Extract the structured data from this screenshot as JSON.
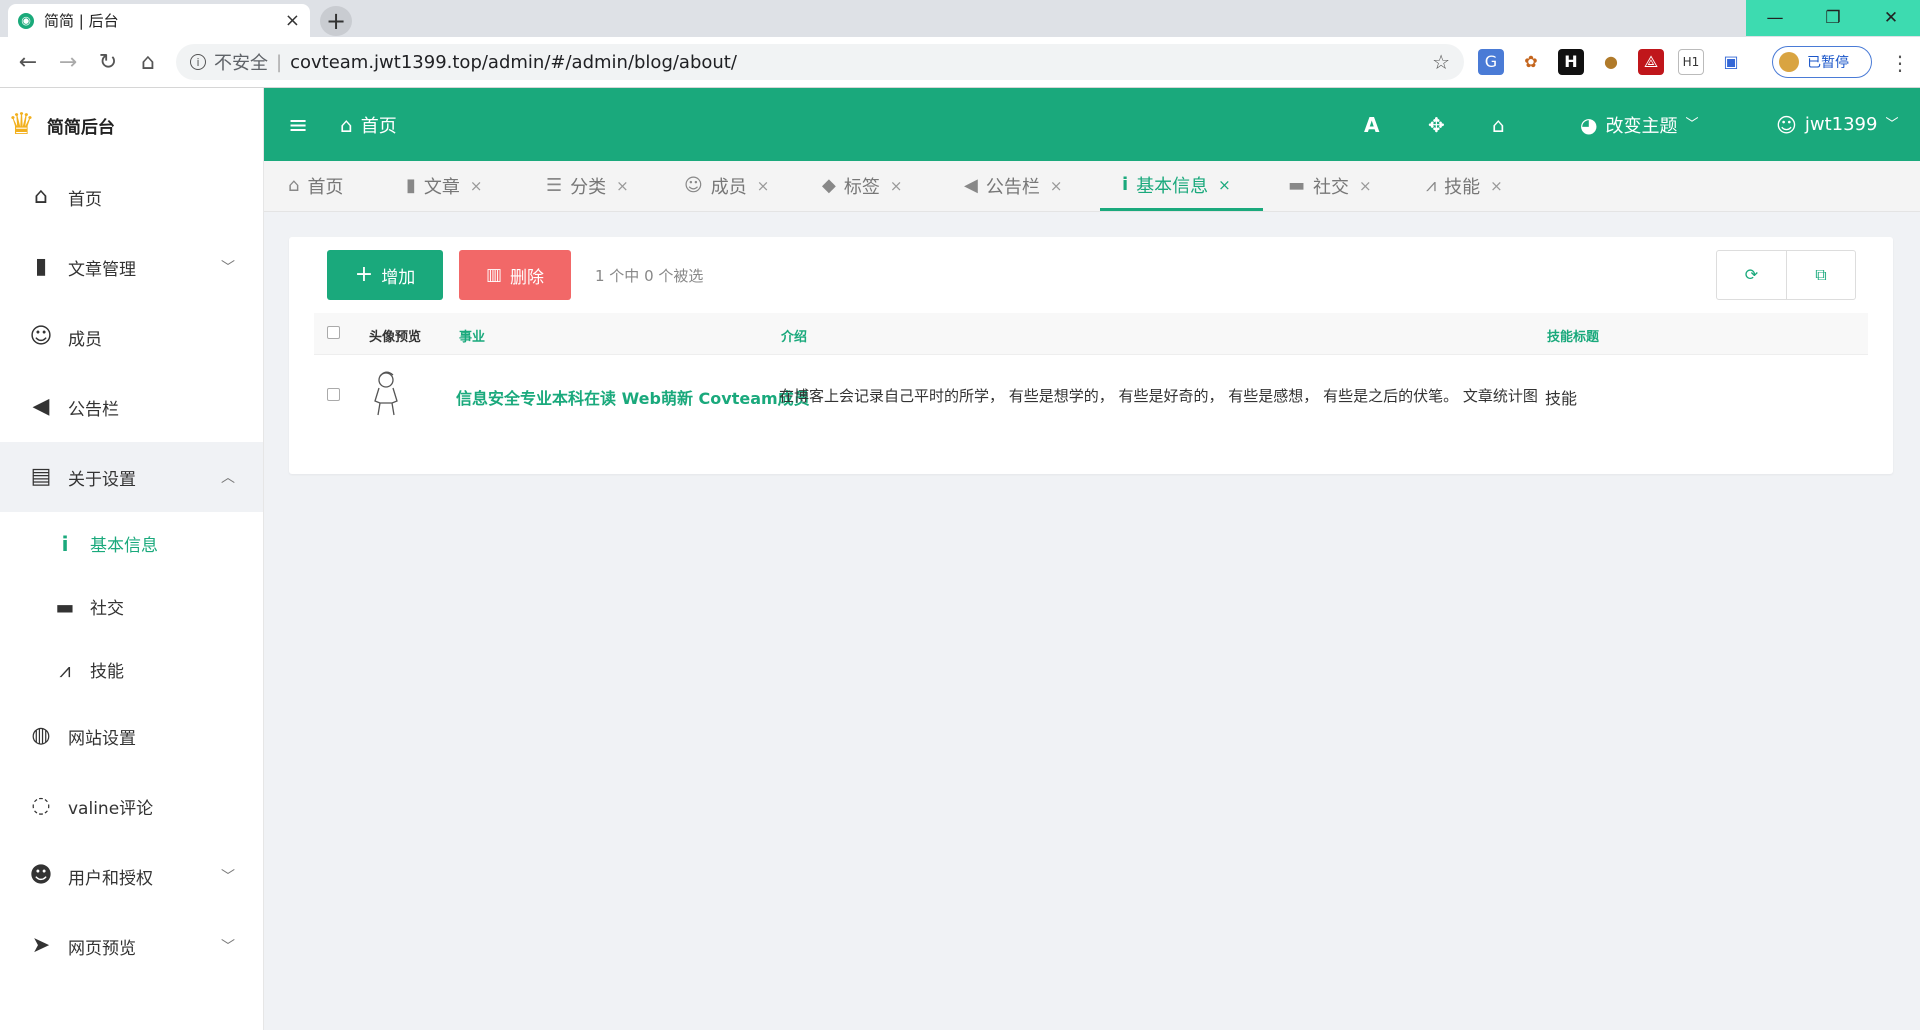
{
  "browser": {
    "tab_title": "简简 | 后台",
    "tab_close": "×",
    "new_tab": "+",
    "win_min": "—",
    "win_restore": "❐",
    "win_close": "✕",
    "back": "←",
    "forward": "→",
    "reload": "↻",
    "home": "⌂",
    "insecure_label": "不安全",
    "sep": "|",
    "url": "covteam.jwt1399.top/admin/#/admin/blog/about/",
    "star": "☆",
    "paused_label": "已暂停",
    "menu": "⋮",
    "ext_h1": "H1"
  },
  "sidebar": {
    "brand": "简简后台",
    "items": [
      {
        "label": "首页",
        "icon": "home-icon"
      },
      {
        "label": "文章管理",
        "icon": "book-icon",
        "caret": "﹀"
      },
      {
        "label": "成员",
        "icon": "user-icon"
      },
      {
        "label": "公告栏",
        "icon": "bullhorn-icon"
      },
      {
        "label": "关于设置",
        "icon": "id-card-icon",
        "caret": "︿"
      },
      {
        "label": "网站设置",
        "icon": "globe-icon"
      },
      {
        "label": "valine评论",
        "icon": "comments-icon"
      },
      {
        "label": "用户和授权",
        "icon": "user-lock-icon",
        "caret": "﹀"
      },
      {
        "label": "网页预览",
        "icon": "paper-plane-icon",
        "caret": "﹀"
      }
    ],
    "sub_items": [
      {
        "label": "基本信息",
        "icon": "info-icon"
      },
      {
        "label": "社交",
        "icon": "comment-icon"
      },
      {
        "label": "技能",
        "icon": "drafting-compass-icon"
      }
    ]
  },
  "header": {
    "hamburger": "≡",
    "home_label": "首页",
    "font_icon": "A",
    "theme_label": "改变主题",
    "user_label": "jwt1399",
    "caret": "﹀"
  },
  "page_tabs": [
    {
      "label": "首页",
      "icon": "home-icon",
      "closable": false
    },
    {
      "label": "文章",
      "icon": "book-icon",
      "closable": true
    },
    {
      "label": "分类",
      "icon": "list-icon",
      "closable": true
    },
    {
      "label": "成员",
      "icon": "user-icon",
      "closable": true
    },
    {
      "label": "标签",
      "icon": "tags-icon",
      "closable": true
    },
    {
      "label": "公告栏",
      "icon": "bullhorn-icon",
      "closable": true
    },
    {
      "label": "基本信息",
      "icon": "info-icon",
      "closable": true,
      "active": true
    },
    {
      "label": "社交",
      "icon": "comment-icon",
      "closable": true
    },
    {
      "label": "技能",
      "icon": "drafting-compass-icon",
      "closable": true
    }
  ],
  "tab_close": "×",
  "content": {
    "add_button": "增加",
    "delete_button": "删除",
    "selection_info": "1 个中 0 个被选",
    "table": {
      "headers": [
        "头像预览",
        "事业",
        "介绍",
        "技能标题"
      ],
      "rows": [
        {
          "career": "信息安全专业本科在读 Web萌新 Covteam成员",
          "intro": "在博客上会记录自己平时的所学， 有些是想学的， 有些是好奇的， 有些是感想， 有些是之后的伏笔。 文章统计图",
          "skill_title": "技能"
        }
      ]
    }
  },
  "colors": {
    "primary": "#1aa97c",
    "danger": "#f26868",
    "window_controls": "#3ddbb0",
    "brand_crown": "#f2b01e"
  }
}
